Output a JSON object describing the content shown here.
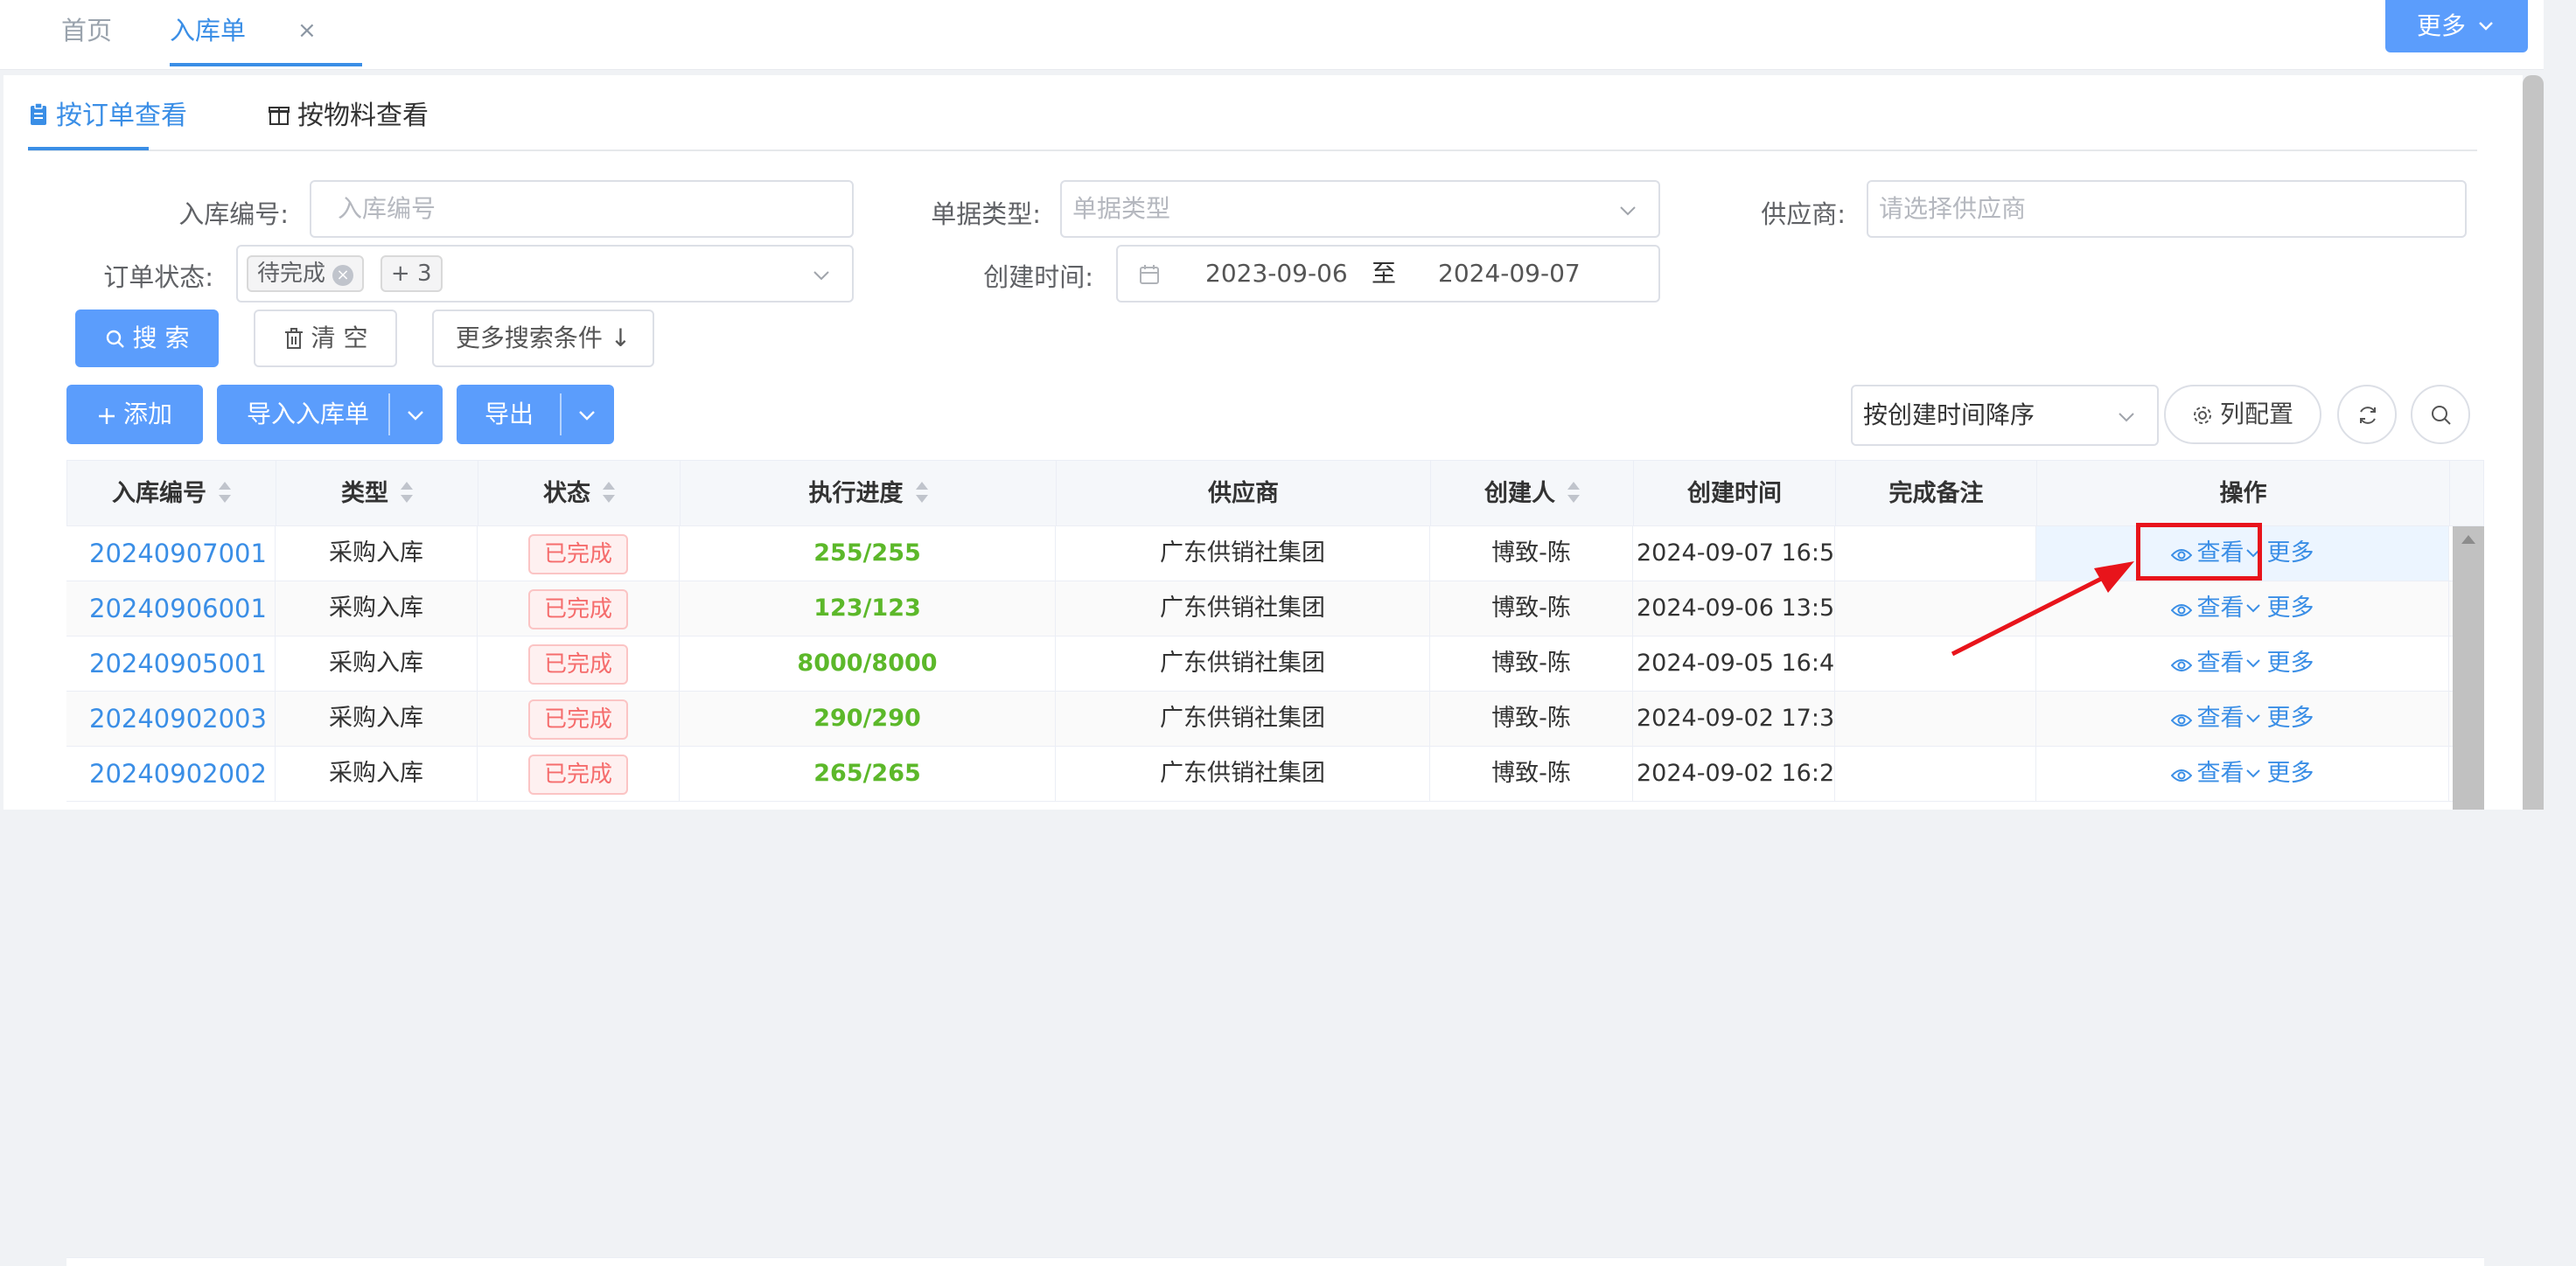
{
  "top_tabs": {
    "home": "首页",
    "active": "入库单",
    "close": "×"
  },
  "more_button": "更多",
  "sub_tabs": {
    "by_order": "按订单查看",
    "by_material": "按物料查看"
  },
  "form": {
    "code_label": "入库编号:",
    "code_placeholder": "入库编号",
    "type_label": "单据类型:",
    "type_placeholder": "单据类型",
    "supplier_label": "供应商:",
    "supplier_placeholder": "请选择供应商",
    "status_label": "订单状态:",
    "status_tag": "待完成",
    "status_more": "+ 3",
    "time_label": "创建时间:",
    "date_start": "2023-09-06",
    "date_sep": "至",
    "date_end": "2024-09-07"
  },
  "buttons": {
    "search": "搜 索",
    "clear": "清 空",
    "more_conditions": "更多搜索条件 ↓",
    "add": "添加",
    "import": "导入入库单",
    "export": "导出",
    "sort_select": "按创建时间降序",
    "column_config": "列配置"
  },
  "table": {
    "headers": [
      "入库编号",
      "类型",
      "状态",
      "执行进度",
      "供应商",
      "创建人",
      "创建时间",
      "完成备注",
      "操作"
    ],
    "rows": [
      {
        "code": "20240907001",
        "type": "采购入库",
        "status": "已完成",
        "progress": "255/255",
        "supplier": "广东供销社集团",
        "creator": "博致-陈",
        "time": "2024-09-07 16:5...",
        "remark": ""
      },
      {
        "code": "20240906001",
        "type": "采购入库",
        "status": "已完成",
        "progress": "123/123",
        "supplier": "广东供销社集团",
        "creator": "博致-陈",
        "time": "2024-09-06 13:5...",
        "remark": ""
      },
      {
        "code": "20240905001",
        "type": "采购入库",
        "status": "已完成",
        "progress": "8000/8000",
        "supplier": "广东供销社集团",
        "creator": "博致-陈",
        "time": "2024-09-05 16:4...",
        "remark": ""
      },
      {
        "code": "20240902003",
        "type": "采购入库",
        "status": "已完成",
        "progress": "290/290",
        "supplier": "广东供销社集团",
        "creator": "博致-陈",
        "time": "2024-09-02 17:3...",
        "remark": ""
      },
      {
        "code": "20240902002",
        "type": "采购入库",
        "status": "已完成",
        "progress": "265/265",
        "supplier": "广东供销社集团",
        "creator": "博致-陈",
        "time": "2024-09-02 16:2...",
        "remark": ""
      }
    ],
    "op_view": "查看",
    "op_more": "更多"
  },
  "colors": {
    "accent": "#5b9dfc",
    "link": "#3a8ee6",
    "success": "#5cb82a",
    "danger": "#f56c6c",
    "annotation": "#e8141b"
  },
  "icons": [
    "clipboard-icon",
    "box-icon",
    "close-icon",
    "chevron-down-icon",
    "calendar-icon",
    "search-icon",
    "trash-icon",
    "plus-icon",
    "gear-icon",
    "refresh-icon",
    "eye-icon",
    "sort-icon"
  ]
}
